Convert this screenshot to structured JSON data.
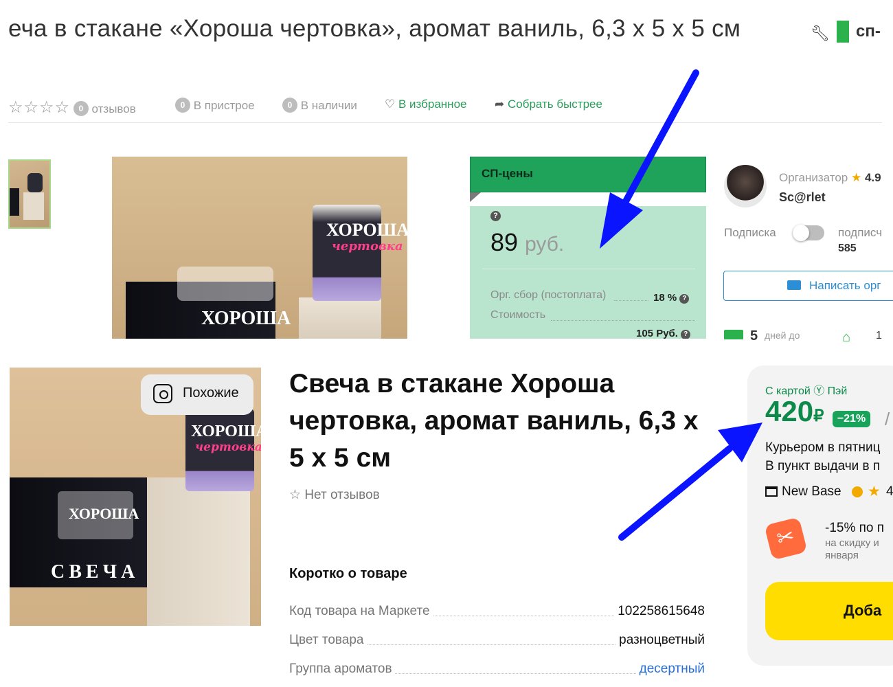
{
  "top": {
    "title": "еча в стакане «Хороша чертовка», аромат ваниль, 6,3 x 5 x 5 см",
    "wrench_icon": "wrench-icon",
    "sp_tag": "сп-",
    "reviews_count": "0",
    "reviews_label": "отзывов",
    "in_pristroy_count": "0",
    "in_pristroy_label": "В пристрое",
    "in_stock_count": "0",
    "in_stock_label": "В наличии",
    "favorite_label": "В избранное",
    "collect_label": "Собрать быстрее",
    "sp_prices": {
      "header": "СП-цены",
      "price": "89",
      "currency": "руб.",
      "org_fee_label": "Орг. сбор (постоплата)",
      "org_fee_value": "18 %",
      "cost_label": "Стоимость",
      "cost_value": "105 Руб."
    },
    "organizer": {
      "label": "Организатор",
      "rating": "4.9",
      "name": "Sc@rlet",
      "subscription_label": "Подписка",
      "subscribers_label": "подписч",
      "subscribers_count": "585",
      "write_button": "Написать орг",
      "days_num": "5",
      "days_label": "дней до",
      "bag_num": "1"
    }
  },
  "bottom": {
    "similar_button": "Похожие",
    "title": "Свеча в стакане Хороша чертовка, аромат ваниль, 6,3 x 5 x 5 см",
    "no_reviews": "Нет отзывов",
    "short_heading": "Коротко о товаре",
    "specs": [
      {
        "key": "Код товара на Маркете",
        "value": "102258615648"
      },
      {
        "key": "Цвет товара",
        "value": "разноцветный"
      },
      {
        "key": "Группа ароматов",
        "value": "десертный"
      }
    ],
    "card": {
      "pay_label": "С картой Ⓨ Пэй",
      "price": "420",
      "currency": "₽",
      "discount": "−21%",
      "slash": "/",
      "courier": "Курьером в пятниц",
      "pickup": "В пункт выдачи в п",
      "shop": "New Base",
      "shop_rating": "4",
      "deal": "-15% по п",
      "deal_sub": "на скидку и января",
      "add_button": "Доба"
    }
  },
  "colors": {
    "sp_green": "#1fa35a",
    "sp_light": "#b9e5cf",
    "market_green": "#0d8a4a",
    "arrow_blue": "#0a14ff",
    "add_yellow": "#ffdd00"
  }
}
